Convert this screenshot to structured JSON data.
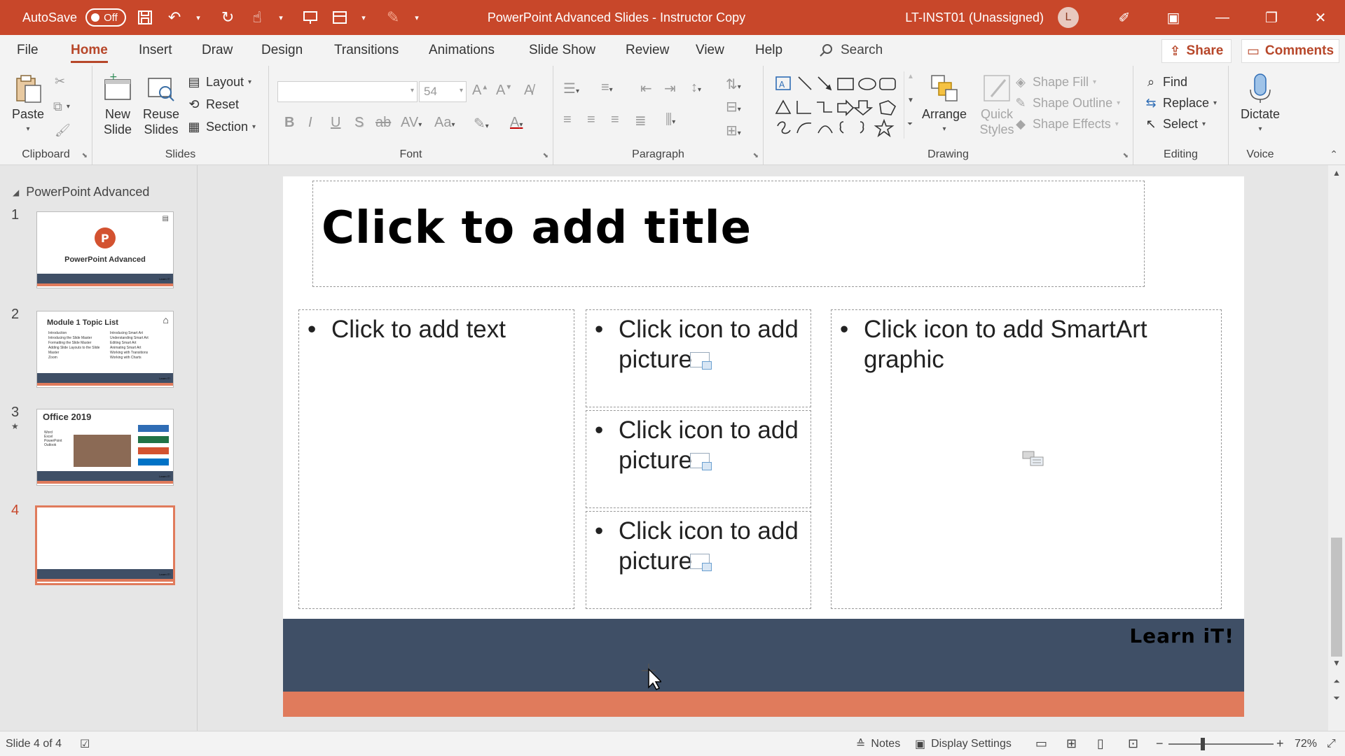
{
  "titlebar": {
    "autosave_label": "AutoSave",
    "autosave_state": "Off",
    "doc_title": "PowerPoint Advanced Slides - Instructor Copy",
    "user": "LT-INST01 (Unassigned)",
    "avatar_initial": "L",
    "bg_color": "#c8472a"
  },
  "tabs": [
    "File",
    "Home",
    "Insert",
    "Draw",
    "Design",
    "Transitions",
    "Animations",
    "Slide Show",
    "Review",
    "View",
    "Help"
  ],
  "active_tab": "Home",
  "search": {
    "label": "Search"
  },
  "share_label": "Share",
  "comments_label": "Comments",
  "ribbon": {
    "clipboard": {
      "label": "Clipboard",
      "paste": "Paste"
    },
    "slides": {
      "label": "Slides",
      "new_slide_1": "New",
      "new_slide_2": "Slide",
      "reuse_1": "Reuse",
      "reuse_2": "Slides",
      "layout": "Layout",
      "reset": "Reset",
      "section": "Section"
    },
    "font": {
      "label": "Font",
      "font_name": "",
      "font_size": "54",
      "bold": "B",
      "italic": "I",
      "underline": "U",
      "shadow": "S",
      "strike": "ab",
      "spacing": "AV",
      "case": "Aa",
      "font_color": "A"
    },
    "paragraph": {
      "label": "Paragraph"
    },
    "drawing": {
      "label": "Drawing",
      "arrange": "Arrange",
      "quick_1": "Quick",
      "quick_2": "Styles",
      "shape_fill": "Shape Fill",
      "shape_outline": "Shape Outline",
      "shape_effects": "Shape Effects"
    },
    "editing": {
      "label": "Editing",
      "find": "Find",
      "replace": "Replace",
      "select": "Select"
    },
    "voice": {
      "label": "Voice",
      "dictate": "Dictate"
    }
  },
  "slide_pane": {
    "section_title": "PowerPoint Advanced",
    "slides": [
      {
        "num": "1",
        "title": "PowerPoint Advanced",
        "footer": "Learn iT!"
      },
      {
        "num": "2",
        "title": "Module 1 Topic List",
        "col1": [
          "Introduction",
          "Introducing the Slide Master",
          "Formatting the Slide Master",
          "Adding Slide Layouts to the Slide Master",
          "Zoom"
        ],
        "col2": [
          "Introducing Smart Art",
          "Understanding Smart Art",
          "Editing Smart Art",
          "Animating Smart Art",
          "Working with Transitions",
          "Working with Charts"
        ],
        "footer": "Learn iT!"
      },
      {
        "num": "3",
        "title": "Office 2019",
        "items": [
          "Word",
          "Excel",
          "PowerPoint",
          "Outlook"
        ],
        "footer": "Learn iT!"
      },
      {
        "num": "4",
        "footer": "Learn iT!"
      }
    ],
    "active_slide": "4"
  },
  "slide": {
    "title_placeholder": "Click to add title",
    "text_placeholder": "Click to add text",
    "picture_placeholder": "Click icon to add picture",
    "smartart_placeholder": "Click icon to add SmartArt graphic",
    "footer_text": "Learn iT!",
    "band_color": "#3f4f66",
    "accent_color": "#e07b5c"
  },
  "statusbar": {
    "slide_info": "Slide 4 of 4",
    "notes": "Notes",
    "display_settings": "Display Settings",
    "zoom": "72%"
  }
}
